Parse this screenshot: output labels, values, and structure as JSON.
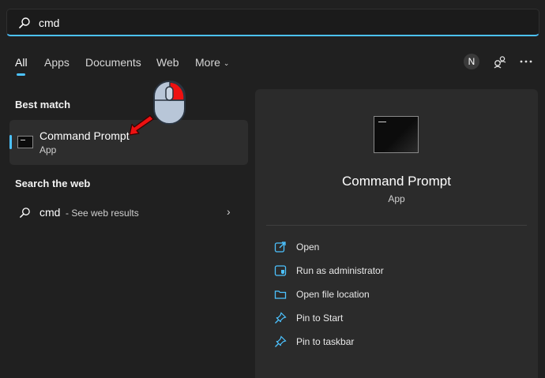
{
  "search": {
    "value": "cmd",
    "accent": "#4cc2ff"
  },
  "tabs": [
    {
      "label": "All",
      "active": true
    },
    {
      "label": "Apps"
    },
    {
      "label": "Documents"
    },
    {
      "label": "Web"
    },
    {
      "label": "More"
    }
  ],
  "header": {
    "avatar_initial": "N",
    "icons": [
      "people-connect-icon",
      "more-icon"
    ]
  },
  "best_match": {
    "heading": "Best match",
    "title": "Command Prompt",
    "subtitle": "App",
    "icon": "command-prompt-icon"
  },
  "search_web": {
    "heading": "Search the web",
    "query": "cmd",
    "suffix": "- See web results"
  },
  "preview": {
    "title": "Command Prompt",
    "subtitle": "App",
    "actions": [
      {
        "label": "Open",
        "icon": "open-icon"
      },
      {
        "label": "Run as administrator",
        "icon": "shield-icon"
      },
      {
        "label": "Open file location",
        "icon": "folder-icon"
      },
      {
        "label": "Pin to Start",
        "icon": "pin-icon"
      },
      {
        "label": "Pin to taskbar",
        "icon": "pin-icon"
      }
    ]
  },
  "colors": {
    "background": "#202020",
    "panel": "#2b2b2b",
    "card": "#2d2d2d",
    "accent": "#4cc2ff",
    "annotation": "#e81010"
  }
}
